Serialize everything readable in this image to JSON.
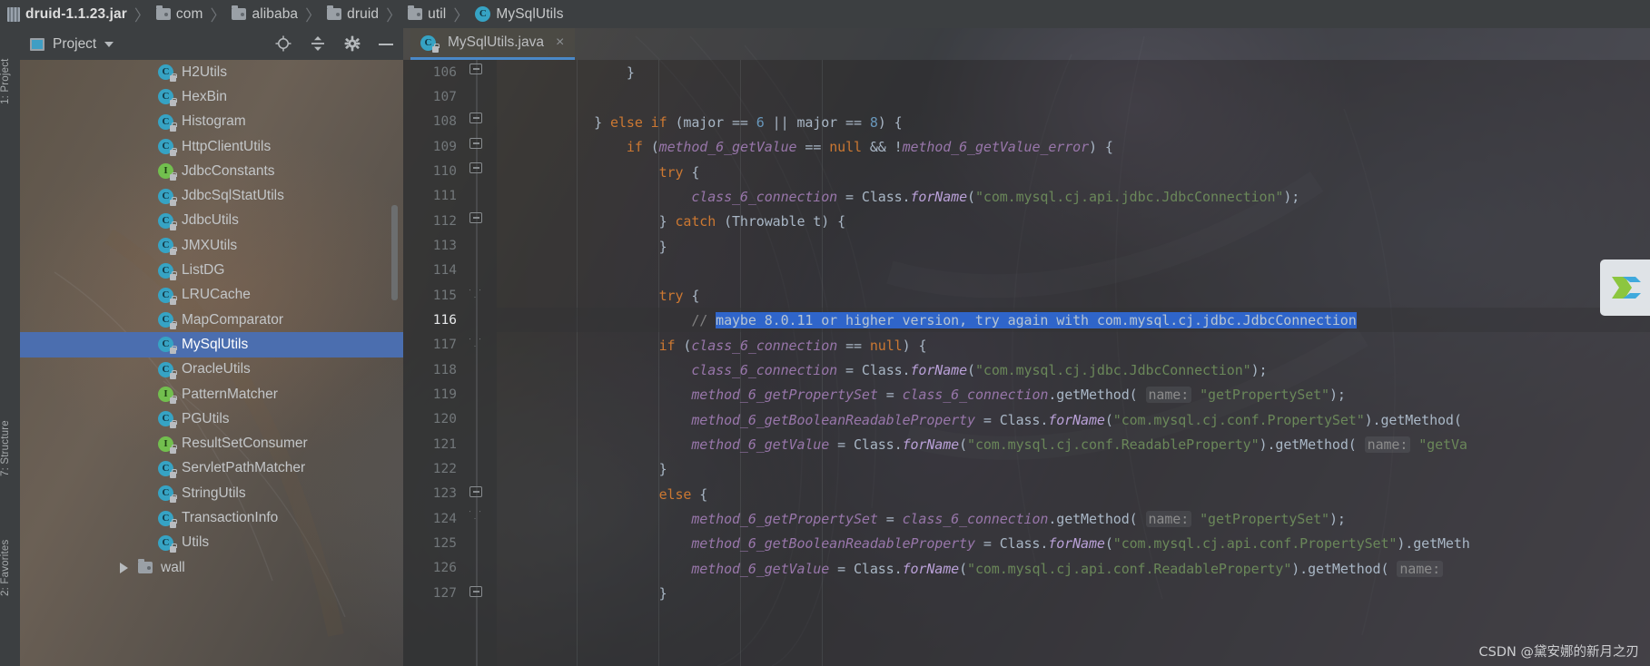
{
  "breadcrumb": {
    "items": [
      {
        "label": "druid-1.1.23.jar",
        "icon": "jar-icon",
        "bold": true
      },
      {
        "label": "com",
        "icon": "folder-icon",
        "bold": false
      },
      {
        "label": "alibaba",
        "icon": "folder-icon",
        "bold": false
      },
      {
        "label": "druid",
        "icon": "folder-icon",
        "bold": false
      },
      {
        "label": "util",
        "icon": "folder-icon",
        "bold": false
      },
      {
        "label": "MySqlUtils",
        "icon": "class-icon",
        "bold": false
      }
    ],
    "separator": "〉"
  },
  "left_strip": {
    "project_label": "1: Project",
    "structure_label": "7: Structure",
    "favorites_label": "2: Favorites"
  },
  "project_panel": {
    "title": "Project",
    "dropdown_caret": "▾",
    "buttons": [
      {
        "name": "locate-icon",
        "tooltip": "Select Opened File"
      },
      {
        "name": "collapse-all-icon",
        "tooltip": "Collapse All"
      },
      {
        "name": "gear-icon",
        "tooltip": "Settings"
      },
      {
        "name": "minimize-icon",
        "tooltip": "Hide"
      }
    ],
    "tree": [
      {
        "label": "H2Utils",
        "icon": "class-icon",
        "selected": false
      },
      {
        "label": "HexBin",
        "icon": "class-icon",
        "selected": false
      },
      {
        "label": "Histogram",
        "icon": "class-icon",
        "selected": false
      },
      {
        "label": "HttpClientUtils",
        "icon": "class-icon",
        "selected": false
      },
      {
        "label": "JdbcConstants",
        "icon": "interface-icon",
        "selected": false
      },
      {
        "label": "JdbcSqlStatUtils",
        "icon": "class-icon",
        "selected": false
      },
      {
        "label": "JdbcUtils",
        "icon": "class-icon",
        "selected": false
      },
      {
        "label": "JMXUtils",
        "icon": "class-icon",
        "selected": false
      },
      {
        "label": "ListDG",
        "icon": "class-icon",
        "selected": false
      },
      {
        "label": "LRUCache",
        "icon": "class-icon",
        "selected": false
      },
      {
        "label": "MapComparator",
        "icon": "class-icon",
        "selected": false
      },
      {
        "label": "MySqlUtils",
        "icon": "class-icon",
        "selected": true
      },
      {
        "label": "OracleUtils",
        "icon": "class-icon",
        "selected": false
      },
      {
        "label": "PatternMatcher",
        "icon": "interface-icon",
        "selected": false
      },
      {
        "label": "PGUtils",
        "icon": "class-icon",
        "selected": false
      },
      {
        "label": "ResultSetConsumer",
        "icon": "interface-icon",
        "selected": false
      },
      {
        "label": "ServletPathMatcher",
        "icon": "class-icon",
        "selected": false
      },
      {
        "label": "StringUtils",
        "icon": "class-icon",
        "selected": false
      },
      {
        "label": "TransactionInfo",
        "icon": "class-icon",
        "selected": false
      },
      {
        "label": "Utils",
        "icon": "class-icon",
        "selected": false
      },
      {
        "label": "wall",
        "icon": "folder-icon",
        "selected": false,
        "expandable": true
      }
    ]
  },
  "editor": {
    "tab": {
      "label": "MySqlUtils.java",
      "icon": "class-icon",
      "close": "×"
    },
    "current_line": 116,
    "first_line": 106,
    "lines": [
      {
        "n": 106,
        "indent": 10,
        "fold": "box"
      },
      {
        "n": 107,
        "indent": 0
      },
      {
        "n": 108,
        "indent": 8,
        "fold": "box"
      },
      {
        "n": 109,
        "indent": 10,
        "fold": "box"
      },
      {
        "n": 110,
        "indent": 12,
        "fold": "box"
      },
      {
        "n": 111,
        "indent": 14
      },
      {
        "n": 112,
        "indent": 12,
        "fold": "box"
      },
      {
        "n": 113,
        "indent": 12
      },
      {
        "n": 114,
        "indent": 0
      },
      {
        "n": 115,
        "indent": 12,
        "fold": "end"
      },
      {
        "n": 116,
        "indent": 14
      },
      {
        "n": 117,
        "indent": 12,
        "fold": "end"
      },
      {
        "n": 118,
        "indent": 16
      },
      {
        "n": 119,
        "indent": 16
      },
      {
        "n": 120,
        "indent": 16
      },
      {
        "n": 121,
        "indent": 16
      },
      {
        "n": 122,
        "indent": 14,
        "fold": "box"
      },
      {
        "n": 123,
        "indent": 12,
        "fold": "end"
      },
      {
        "n": 124,
        "indent": 16
      },
      {
        "n": 125,
        "indent": 16
      },
      {
        "n": 126,
        "indent": 16
      },
      {
        "n": 127,
        "indent": 14,
        "fold": "box"
      }
    ],
    "code": {
      "l106": "                }",
      "l108": "            } else if (major == 6 || major == 8) {",
      "l109": "                if (method_6_getValue == null && !method_6_getValue_error) {",
      "l110": "                    try {",
      "l111": "                        class_6_connection = Class.forName(\"com.mysql.cj.api.jdbc.JdbcConnection\");",
      "l112": "                    } catch (Throwable t) {",
      "l113": "                    }",
      "l115": "                    try {",
      "l116_prefix": "                        // ",
      "l116_selected": "maybe 8.0.11 or higher version, try again with com.mysql.cj.jdbc.JdbcConnection",
      "l117": "                    if (class_6_connection == null) {",
      "l118": "                        class_6_connection = Class.forName(\"com.mysql.cj.jdbc.JdbcConnection\");",
      "l119": "                        method_6_getPropertySet = class_6_connection.getMethod( name: \"getPropertySet\");",
      "l120": "                        method_6_getBooleanReadableProperty = Class.forName(\"com.mysql.cj.conf.PropertySet\").getMethod(",
      "l121": "                        method_6_getValue = Class.forName(\"com.mysql.cj.conf.ReadableProperty\").getMethod( name: \"getVa",
      "l122": "                    }",
      "l123": "                    else {",
      "l124": "                        method_6_getPropertySet = class_6_connection.getMethod( name: \"getPropertySet\");",
      "l125": "                        method_6_getBooleanReadableProperty = Class.forName(\"com.mysql.cj.api.conf.PropertySet\").getMeth",
      "l126": "                        method_6_getValue = Class.forName(\"com.mysql.cj.api.conf.ReadableProperty\").getMethod( name:",
      "l127": "                    }"
    }
  },
  "watermark": "CSDN @黛安娜的新月之刃",
  "colors": {
    "selection_blue": "#2f65ca",
    "tree_selection": "#4b6eaf",
    "keyword_orange": "#cc7832",
    "string_green": "#6a8759",
    "number_blue": "#6897bb",
    "field_purple": "#9876aa",
    "comment_gray": "#808080",
    "default_text": "#a9b7c6",
    "tab_underline": "#4a88c7",
    "class_icon": "#36a3c4",
    "interface_icon": "#72bf4e"
  }
}
